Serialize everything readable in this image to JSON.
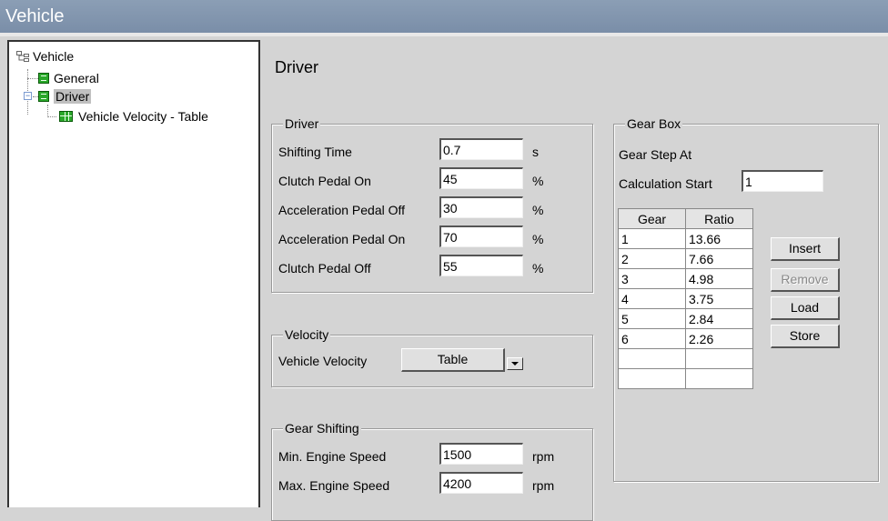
{
  "window": {
    "title": "Vehicle"
  },
  "tree": {
    "root": "Vehicle",
    "items": [
      {
        "label": "General"
      },
      {
        "label": "Driver"
      },
      {
        "label": "Vehicle Velocity - Table"
      }
    ]
  },
  "main": {
    "title": "Driver"
  },
  "driver_group": {
    "legend": "Driver",
    "rows": [
      {
        "label": "Shifting Time",
        "value": "0.7",
        "unit": "s"
      },
      {
        "label": "Clutch Pedal On",
        "value": "45",
        "unit": "%"
      },
      {
        "label": "Acceleration Pedal Off",
        "value": "30",
        "unit": "%"
      },
      {
        "label": "Acceleration Pedal On",
        "value": "70",
        "unit": "%"
      },
      {
        "label": "Clutch Pedal Off",
        "value": "55",
        "unit": "%"
      }
    ]
  },
  "velocity_group": {
    "legend": "Velocity",
    "label": "Vehicle Velocity",
    "button": "Table"
  },
  "gear_shifting_group": {
    "legend": "Gear Shifting",
    "rows": [
      {
        "label": "Min. Engine Speed",
        "value": "1500",
        "unit": "rpm"
      },
      {
        "label": "Max. Engine Speed",
        "value": "4200",
        "unit": "rpm"
      }
    ]
  },
  "gearbox_group": {
    "legend": "Gear Box",
    "step_label": "Gear Step At",
    "calc_label": "Calculation Start",
    "calc_value": "1",
    "table": {
      "headers": [
        "Gear",
        "Ratio"
      ],
      "rows": [
        [
          "1",
          "13.66"
        ],
        [
          "2",
          "7.66"
        ],
        [
          "3",
          "4.98"
        ],
        [
          "4",
          "3.75"
        ],
        [
          "5",
          "2.84"
        ],
        [
          "6",
          "2.26"
        ],
        [
          "",
          ""
        ],
        [
          "",
          ""
        ]
      ]
    },
    "buttons": {
      "insert": "Insert",
      "remove": "Remove",
      "load": "Load",
      "store": "Store"
    }
  }
}
